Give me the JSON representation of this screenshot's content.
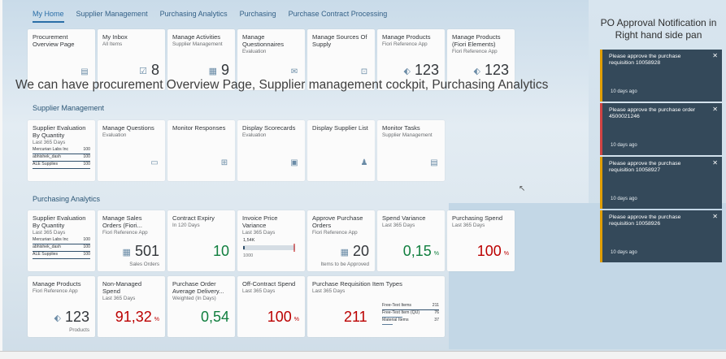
{
  "nav": [
    "My Home",
    "Supplier Management",
    "Purchasing Analytics",
    "Purchasing",
    "Purchase Contract Processing"
  ],
  "sections": {
    "supplier": "Supplier Management",
    "purchasing": "Purchasing Analytics"
  },
  "caption": "We can have procurement Overview Page, Supplier management cockpit, Purchasing Analytics",
  "po_caption": "PO Approval Notification in Right hand side pan",
  "row1": [
    {
      "title": "Procurement Overview Page",
      "sub": "",
      "icon": "overview-icon"
    },
    {
      "title": "My Inbox",
      "sub": "All Items",
      "value": "8",
      "icon": "checkbox-icon"
    },
    {
      "title": "Manage Activities",
      "sub": "Supplier Management",
      "value": "9",
      "icon": "activity-icon"
    },
    {
      "title": "Manage Questionnaires",
      "sub": "Evaluation",
      "icon": "questionnaire-icon"
    },
    {
      "title": "Manage Sources Of Supply",
      "sub": "",
      "icon": "sources-icon"
    },
    {
      "title": "Manage Products",
      "sub": "Fiori Reference App",
      "value": "123",
      "icon": "product-icon"
    },
    {
      "title": "Manage Products (Fiori Elements)",
      "sub": "Fiori Reference App",
      "value": "123",
      "icon": "product-icon"
    }
  ],
  "row2": [
    {
      "title": "Supplier Evaluation By Quantity",
      "sub": "Last 365 Days",
      "rows": [
        {
          "name": "Mercurian Labs Inc",
          "value": "100"
        },
        {
          "name": "abhishek_dash",
          "value": "100"
        },
        {
          "name": "ALE Supplies",
          "value": "100"
        }
      ]
    },
    {
      "title": "Manage Questions",
      "sub": "Evaluation",
      "icon": "question-icon"
    },
    {
      "title": "Monitor Responses",
      "sub": "",
      "icon": "responses-icon"
    },
    {
      "title": "Display Scorecards",
      "sub": "Evaluation",
      "icon": "scorecard-icon"
    },
    {
      "title": "Display Supplier List",
      "sub": "",
      "icon": "supplier-list-icon"
    },
    {
      "title": "Monitor Tasks",
      "sub": "Supplier Management",
      "icon": "tasks-icon"
    }
  ],
  "row3": [
    {
      "title": "Supplier Evaluation By Quantity",
      "sub": "Last 365 Days",
      "rows": [
        {
          "name": "Mercurian Labs Inc",
          "value": "100"
        },
        {
          "name": "abhishek_dash",
          "value": "100"
        },
        {
          "name": "ALE Supplies",
          "value": "100"
        }
      ]
    },
    {
      "title": "Manage Sales Orders (Fiori...",
      "sub": "Fiori Reference App",
      "value": "501",
      "foot": "Sales Orders"
    },
    {
      "title": "Contract Expiry",
      "sub": "In 120 Days",
      "value": "10"
    },
    {
      "title": "Invoice Price Variance",
      "sub": "Last 365 Days",
      "target": "1,54K",
      "min": "1000"
    },
    {
      "title": "Approve Purchase Orders",
      "sub": "Fiori Reference App",
      "value": "20",
      "foot": "Items to be Approved"
    },
    {
      "title": "Spend Variance",
      "sub": "Last 365 Days",
      "value": "0,15",
      "unit": "%"
    },
    {
      "title": "Purchasing Spend",
      "sub": "Last 365 Days",
      "value": "100",
      "unit": "%"
    }
  ],
  "row4": [
    {
      "title": "Manage Products",
      "sub": "Fiori Reference App",
      "value": "123",
      "foot": "Products"
    },
    {
      "title": "Non-Managed Spend",
      "sub": "Last 365 Days",
      "value": "91,32",
      "unit": "%"
    },
    {
      "title": "Purchase Order Average Delivery...",
      "sub": "Weighted (In Days)",
      "value": "0,54"
    },
    {
      "title": "Off-Contract Spend",
      "sub": "Last 365 Days",
      "value": "100",
      "unit": "%"
    },
    {
      "title": "Purchase Requisition Item Types",
      "sub": "Last 365 Days",
      "value": "211",
      "rows": [
        {
          "name": "Free-Text Items",
          "value": "211"
        },
        {
          "name": "Free-Text Item (QU)",
          "value": "76"
        },
        {
          "name": "Material Items",
          "value": "37"
        }
      ]
    }
  ],
  "notifications": [
    {
      "text": "Please approve the purchase requisition 10058928",
      "time": "10 days ago",
      "priority": "orange"
    },
    {
      "text": "Please approve the purchase order 4500021246",
      "time": "10 days ago",
      "priority": "red"
    },
    {
      "text": "Please approve the purchase requisition 10058927",
      "time": "10 days ago",
      "priority": "orange"
    },
    {
      "text": "Please approve the purchase requisition 10058926",
      "time": "10 days ago",
      "priority": "orange"
    }
  ],
  "colors": {
    "accent": "#2a6ea7",
    "positive": "#107e3e",
    "negative": "#bb0000",
    "notification": "#34495a"
  }
}
